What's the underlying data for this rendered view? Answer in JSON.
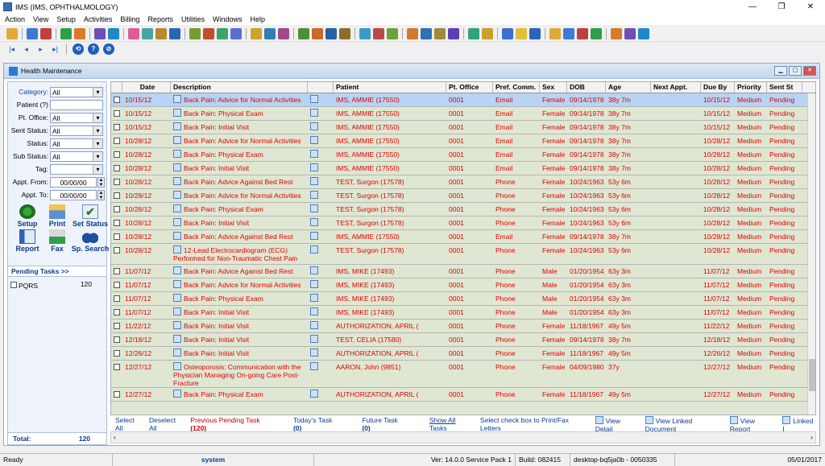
{
  "window": {
    "title": "IMS (IMS, OPHTHALMOLOGY)",
    "min": "—",
    "max": "❐",
    "close": "✕"
  },
  "menu": [
    "Action",
    "View",
    "Setup",
    "Activities",
    "Billing",
    "Reports",
    "Utilities",
    "Windows",
    "Help"
  ],
  "nav": [
    "|◂",
    "◂",
    "▸",
    "▸|"
  ],
  "nav_round": [
    "⟲",
    "?",
    "⊘"
  ],
  "panel": {
    "title": "Health Maintenance",
    "min": "▁",
    "restore": "▢",
    "close": "✕"
  },
  "filters": {
    "category": {
      "label": "Category:",
      "value": "All"
    },
    "patient": {
      "label": "Patient (?)",
      "value": ""
    },
    "pt_office": {
      "label": "Pt. Office:",
      "value": "All"
    },
    "sent_status": {
      "label": "Sent Status:",
      "value": "All"
    },
    "status": {
      "label": "Status:",
      "value": "All"
    },
    "sub_status": {
      "label": "Sub Status:",
      "value": "All"
    },
    "tag": {
      "label": "Tag:",
      "value": ""
    },
    "appt_from": {
      "label": "Appt. From:",
      "value": "00/00/00"
    },
    "appt_to": {
      "label": "Appt. To:",
      "value": "00/00/00"
    }
  },
  "actions": {
    "setup": "Setup",
    "print": "Print",
    "set_status": "Set Status",
    "report": "Report",
    "fax": "Fax",
    "sp_search": "Sp. Search"
  },
  "pending": {
    "header": "Pending Tasks >>",
    "items": [
      {
        "name": "PQRS",
        "count": "120"
      }
    ]
  },
  "total": {
    "label": "Total:",
    "value": "120"
  },
  "columns": [
    "",
    "Date",
    "Description",
    "",
    "Patient",
    "Pt. Office",
    "Pref. Comm.",
    "Sex",
    "DOB",
    "Age",
    "Next Appt.",
    "Due By",
    "Priority",
    "Sent St"
  ],
  "rows": [
    {
      "date": "10/15/12",
      "desc": "Back Pain: Advice for Normal Activities",
      "patient": "IMS, AMMIE  (17550)",
      "office": "0001",
      "comm": "Email",
      "sex": "Female",
      "dob": "09/14/1978",
      "age": "38y 7m",
      "next": "",
      "due": "10/15/12",
      "priority": "Medium",
      "sent": "Pending"
    },
    {
      "date": "10/15/12",
      "desc": "Back Pain: Physical Exam",
      "patient": "IMS, AMMIE  (17550)",
      "office": "0001",
      "comm": "Email",
      "sex": "Female",
      "dob": "09/14/1978",
      "age": "38y 7m",
      "next": "",
      "due": "10/15/12",
      "priority": "Medium",
      "sent": "Pending"
    },
    {
      "date": "10/15/12",
      "desc": "Back Pain: Initial Visit",
      "patient": "IMS, AMMIE  (17550)",
      "office": "0001",
      "comm": "Email",
      "sex": "Female",
      "dob": "09/14/1978",
      "age": "38y 7m",
      "next": "",
      "due": "10/15/12",
      "priority": "Medium",
      "sent": "Pending"
    },
    {
      "date": "10/28/12",
      "desc": "Back Pain: Advice for Normal Activities",
      "patient": "IMS, AMMIE  (17550)",
      "office": "0001",
      "comm": "Email",
      "sex": "Female",
      "dob": "09/14/1978",
      "age": "38y 7m",
      "next": "",
      "due": "10/28/12",
      "priority": "Medium",
      "sent": "Pending"
    },
    {
      "date": "10/28/12",
      "desc": "Back Pain: Physical Exam",
      "patient": "IMS, AMMIE  (17550)",
      "office": "0001",
      "comm": "Email",
      "sex": "Female",
      "dob": "09/14/1978",
      "age": "38y 7m",
      "next": "",
      "due": "10/28/12",
      "priority": "Medium",
      "sent": "Pending"
    },
    {
      "date": "10/28/12",
      "desc": "Back Pain: Initial Visit",
      "patient": "IMS, AMMIE  (17550)",
      "office": "0001",
      "comm": "Email",
      "sex": "Female",
      "dob": "09/14/1978",
      "age": "38y 7m",
      "next": "",
      "due": "10/28/12",
      "priority": "Medium",
      "sent": "Pending"
    },
    {
      "date": "10/28/12",
      "desc": "Back Pain: Advice Against Bed Rest",
      "patient": "TEST, Surgon  (17578)",
      "office": "0001",
      "comm": "Phone",
      "sex": "Female",
      "dob": "10/24/1963",
      "age": "53y 6m",
      "next": "",
      "due": "10/28/12",
      "priority": "Medium",
      "sent": "Pending"
    },
    {
      "date": "10/28/12",
      "desc": "Back Pain: Advice for Normal Activities",
      "patient": "TEST, Surgon  (17578)",
      "office": "0001",
      "comm": "Phone",
      "sex": "Female",
      "dob": "10/24/1963",
      "age": "53y 6m",
      "next": "",
      "due": "10/28/12",
      "priority": "Medium",
      "sent": "Pending"
    },
    {
      "date": "10/28/12",
      "desc": "Back Pain: Physical Exam",
      "patient": "TEST, Surgon  (17578)",
      "office": "0001",
      "comm": "Phone",
      "sex": "Female",
      "dob": "10/24/1963",
      "age": "53y 6m",
      "next": "",
      "due": "10/28/12",
      "priority": "Medium",
      "sent": "Pending"
    },
    {
      "date": "10/28/12",
      "desc": "Back Pain: Initial Visit",
      "patient": "TEST, Surgon  (17578)",
      "office": "0001",
      "comm": "Phone",
      "sex": "Female",
      "dob": "10/24/1963",
      "age": "53y 6m",
      "next": "",
      "due": "10/28/12",
      "priority": "Medium",
      "sent": "Pending"
    },
    {
      "date": "10/28/12",
      "desc": "Back Pain: Advice Against Bed Rest",
      "patient": "IMS, AMMIE  (17550)",
      "office": "0001",
      "comm": "Email",
      "sex": "Female",
      "dob": "09/14/1978",
      "age": "38y 7m",
      "next": "",
      "due": "10/28/12",
      "priority": "Medium",
      "sent": "Pending"
    },
    {
      "date": "10/28/12",
      "desc": "12-Lead Electrocardiogram (ECG) Performed for Non-Traumatic Chest Pain",
      "patient": "TEST, Surgon  (17578)",
      "office": "0001",
      "comm": "Phone",
      "sex": "Female",
      "dob": "10/24/1963",
      "age": "53y 6m",
      "next": "",
      "due": "10/28/12",
      "priority": "Medium",
      "sent": "Pending",
      "lines": 2
    },
    {
      "date": "11/07/12",
      "desc": "Back Pain: Advice Against Bed Rest",
      "patient": "IMS, MIKE  (17493)",
      "office": "0001",
      "comm": "Phone",
      "sex": "Male",
      "dob": "01/20/1954",
      "age": "63y 3m",
      "next": "",
      "due": "11/07/12",
      "priority": "Medium",
      "sent": "Pending"
    },
    {
      "date": "11/07/12",
      "desc": "Back Pain: Advice for Normal Activities",
      "patient": "IMS, MIKE  (17493)",
      "office": "0001",
      "comm": "Phone",
      "sex": "Male",
      "dob": "01/20/1954",
      "age": "63y 3m",
      "next": "",
      "due": "11/07/12",
      "priority": "Medium",
      "sent": "Pending"
    },
    {
      "date": "11/07/12",
      "desc": "Back Pain: Physical Exam",
      "patient": "IMS, MIKE  (17493)",
      "office": "0001",
      "comm": "Phone",
      "sex": "Male",
      "dob": "01/20/1954",
      "age": "63y 3m",
      "next": "",
      "due": "11/07/12",
      "priority": "Medium",
      "sent": "Pending"
    },
    {
      "date": "11/07/12",
      "desc": "Back Pain: Initial Visit",
      "patient": "IMS, MIKE  (17493)",
      "office": "0001",
      "comm": "Phone",
      "sex": "Male",
      "dob": "01/20/1954",
      "age": "63y 3m",
      "next": "",
      "due": "11/07/12",
      "priority": "Medium",
      "sent": "Pending"
    },
    {
      "date": "11/22/12",
      "desc": "Back Pain: Initial Visit",
      "patient": "AUTHORIZATION, APRIL  (",
      "office": "0001",
      "comm": "Phone",
      "sex": "Female",
      "dob": "11/18/1967",
      "age": "49y 5m",
      "next": "",
      "due": "11/22/12",
      "priority": "Medium",
      "sent": "Pending"
    },
    {
      "date": "12/18/12",
      "desc": "Back Pain: Initial Visit",
      "patient": "TEST, CELIA  (17580)",
      "office": "0001",
      "comm": "Phone",
      "sex": "Female",
      "dob": "09/14/1978",
      "age": "38y 7m",
      "next": "",
      "due": "12/18/12",
      "priority": "Medium",
      "sent": "Pending"
    },
    {
      "date": "12/26/12",
      "desc": "Back Pain: Initial Visit",
      "patient": "AUTHORIZATION, APRIL  (",
      "office": "0001",
      "comm": "Phone",
      "sex": "Female",
      "dob": "11/18/1967",
      "age": "49y 5m",
      "next": "",
      "due": "12/26/12",
      "priority": "Medium",
      "sent": "Pending"
    },
    {
      "date": "12/27/12",
      "desc": "Osteoporosis: Communication with the Physician Managing On-going Care Post-Fracture",
      "patient": "AARON, John  (9851)",
      "office": "0001",
      "comm": "Phone",
      "sex": "Female",
      "dob": "04/09/1980",
      "age": "37y",
      "next": "",
      "due": "12/27/12",
      "priority": "Medium",
      "sent": "Pending",
      "lines": 3
    },
    {
      "date": "12/27/12",
      "desc": "Back Pain: Physical Exam",
      "patient": "AUTHORIZATION, APRIL  (",
      "office": "0001",
      "comm": "Phone",
      "sex": "Female",
      "dob": "11/18/1967",
      "age": "49y 5m",
      "next": "",
      "due": "12/27/12",
      "priority": "Medium",
      "sent": "Pending"
    }
  ],
  "bottom": {
    "select_all": "Select All",
    "deselect_all": "Deselect All",
    "previous": "Previous Pending Task",
    "previous_count": "(120)",
    "today": "Today's Task",
    "today_count": "(0)",
    "future": "Future Task",
    "future_count": "(0)",
    "show_all": "Show All Tasks",
    "hint": "Select check box to Print/Fax Letters",
    "view_detail": "View Detail",
    "view_linked": "View Linked Document",
    "view_report": "View Report",
    "linked": "Linked I"
  },
  "status": {
    "ready": "Ready",
    "user": "system",
    "version": "Ver: 14.0.0 Service Pack 1",
    "build": "Build: 082415",
    "machine": "desktop-bq5ja0b - 0050335",
    "date": "05/01/2017"
  },
  "colors": {
    "row_bg": "#dfe7d2",
    "row_text": "#e00000",
    "selected_row": "#b7d4f4"
  }
}
